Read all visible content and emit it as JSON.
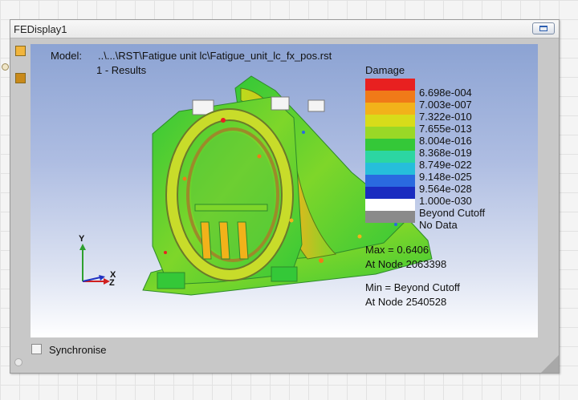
{
  "window": {
    "title": "FEDisplay1"
  },
  "viewport": {
    "model_label": "Model:",
    "model_path": "..\\...\\RST\\Fatigue unit lc\\Fatigue_unit_lc_fx_pos.rst",
    "results_label": "1 - Results",
    "legend": {
      "title": "Damage",
      "items": [
        {
          "label": "6.698e-004",
          "color": "#e82020"
        },
        {
          "label": "7.003e-007",
          "color": "#f07a18"
        },
        {
          "label": "7.322e-010",
          "color": "#f2b21a"
        },
        {
          "label": "7.655e-013",
          "color": "#d8dc1a"
        },
        {
          "label": "8.004e-016",
          "color": "#9ad826"
        },
        {
          "label": "8.368e-019",
          "color": "#34c838"
        },
        {
          "label": "8.749e-022",
          "color": "#2cd6a2"
        },
        {
          "label": "9.148e-025",
          "color": "#26bedb"
        },
        {
          "label": "9.564e-028",
          "color": "#2a6ae0"
        },
        {
          "label": "1.000e-030",
          "color": "#1a2cc0"
        },
        {
          "label": "Beyond Cutoff",
          "color": "#ffffff"
        },
        {
          "label": "No Data",
          "color": "#8a8a8a"
        }
      ]
    },
    "max_label": "Max = 0.6406",
    "max_node": "At Node 2063398",
    "min_label": "Min = Beyond Cutoff",
    "min_node": "At Node 2540528",
    "axes": {
      "y": "Y",
      "x": "X",
      "z": "Z"
    }
  },
  "footer": {
    "synchronise_label": "Synchronise",
    "synchronise_checked": false
  }
}
